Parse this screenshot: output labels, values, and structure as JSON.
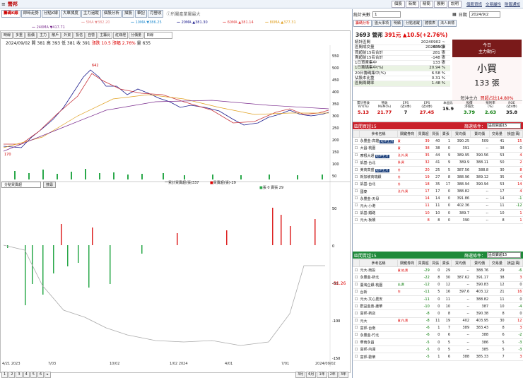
{
  "app": {
    "title": "營邦",
    "window_controls": [
      "個股",
      "新聞",
      "精簡",
      "展開",
      "說明"
    ],
    "links": [
      "個股資訊",
      "交易屬性",
      "財報通知"
    ]
  },
  "chart_tabs": [
    "籌碼K線",
    "即時走勢",
    "分點K線",
    "大單揉度",
    "主力追蹤",
    "個股分析",
    "描股",
    "筆記",
    "月營收"
  ],
  "chart_tabs_note": "ⓘ所屬產業屬最大",
  "ma": [
    {
      "label": "5MA ▼382.20",
      "color": "#e58a8a"
    },
    {
      "label": "10MA ▼386.25",
      "color": "#2a8fd0"
    },
    {
      "label": "20MA ▲381.30",
      "color": "#1a1a8c"
    },
    {
      "label": "60MA ▲381.14",
      "color": "#e23f3f"
    },
    {
      "label": "80MA ▲377.31",
      "color": "#e0a020"
    },
    {
      "label": "240MA ▼417.71",
      "color": "#7b2d8e"
    }
  ],
  "toolbar": [
    "時線",
    "多重",
    "股價",
    "主力",
    "散戶",
    "外資",
    "投信",
    "自營",
    "主籌比",
    "紅綠燈",
    "分價量"
  ],
  "period": "日線",
  "ohlc": {
    "text": "2024/09/02 開 381 高 393 低 381 收 391",
    "chg": "漲跌 10.5",
    "pct": "漲幅 2.76%",
    "vol": "量 635"
  },
  "peak_label": "642",
  "low_label": "170",
  "y_price": [
    "600",
    "550",
    "500",
    "450",
    "400",
    "350",
    "300",
    "250",
    "200",
    "150",
    "100",
    "50"
  ],
  "mid_select": "分點買賣超",
  "mid_button": "搜尋",
  "legend": {
    "line": "一累計買賣超(張)337",
    "buy": "買賣超(張)-29",
    "sell": "張 0 賣張 29"
  },
  "y_lower": [
    "50",
    "0",
    "-50",
    "-100",
    "-150"
  ],
  "last_val": "-31.26",
  "x_labels": [
    "4/21\n2023",
    "7/03",
    "10/02",
    "1/02\n2024",
    "4/01",
    "7/01",
    "2024/09/02"
  ],
  "bottom": {
    "pages": [
      "1",
      "2",
      "3",
      "4",
      "5",
      "6",
      "▸"
    ],
    "ranges": [
      "3月",
      "6月",
      "1年",
      "2年",
      "3年"
    ]
  },
  "controls": {
    "days_label": "統計天數",
    "days": "1",
    "date_label": "日期",
    "date": "2024/9/2"
  },
  "right_tabs": [
    "籌碼分析",
    "盤大事項",
    "明顯",
    "分點追蹤",
    "體檢表",
    "法人目標"
  ],
  "stock": {
    "code_name": "3693 營邦",
    "price": "391元",
    "chg": "▲10.5(+2.76%)"
  },
  "stats": [
    {
      "k": "統計區間",
      "v": "20240902 ~ 20240902",
      "alt": false
    },
    {
      "k": "區間成交量",
      "v": "635 張",
      "alt": false
    },
    {
      "k": "買超前15名合計",
      "v": "281 張",
      "alt": false
    },
    {
      "k": "賣超前15名合計",
      "v": "-148 張",
      "alt": false
    },
    {
      "k": "1日買賣集中",
      "v": "133 張",
      "alt": false
    },
    {
      "k": "1日籌碼集中(%)",
      "v": "20.94 %",
      "alt": true
    },
    {
      "k": "20日籌碼集中(%)",
      "v": "6.58 %",
      "alt": false
    },
    {
      "k": "佔股本比重",
      "v": "0.31 %",
      "alt": false
    },
    {
      "k": "區間周轉率",
      "v": "1.48 %",
      "alt": true
    }
  ],
  "today": {
    "a": "今日",
    "b": "主力動向",
    "action": "小買",
    "qty": "133 張",
    "who": "短沖主力",
    "pct": "買超占比14.80%"
  },
  "fin": [
    {
      "h": "累計營收\nYoY(%)",
      "v": "5.13",
      "c": "red"
    },
    {
      "h": "營收\nMoM(%)",
      "v": "21.77",
      "c": "red"
    },
    {
      "h": "EPS\n(近4季)",
      "v": "7",
      "c": "k"
    },
    {
      "h": "EPS\n(近4季)",
      "v": "27.45",
      "c": "red"
    },
    {
      "h": "本益比",
      "v": "15.9",
      "c": "k"
    },
    {
      "h": "股價\n淨值比",
      "v": "3.79",
      "c": "g"
    },
    {
      "h": "殖利率\n(%)",
      "v": "2.63",
      "c": "g"
    },
    {
      "h": "ROE\n(近4季)",
      "v": "35.8",
      "c": "k"
    }
  ],
  "buy_section": {
    "title": "區間買超15",
    "filter_label": "篩選條件：",
    "filter": "區間買超15"
  },
  "sell_section": {
    "title": "區間賣超15",
    "filter_label": "篩選條件：",
    "filter": "區間賣超15"
  },
  "cols": [
    "參考名稱",
    "關鍵券商",
    "買賣超",
    "買張",
    "賣張",
    "買均價",
    "賣均價",
    "交易量",
    "損益(萬)"
  ],
  "buy_rows": [
    {
      "name": "永豐金-高雄",
      "tag": "短沖主力",
      "k": "買",
      "kc": "red",
      "n": [
        "39",
        "40",
        "1",
        "390.25",
        "509",
        "41",
        "15"
      ]
    },
    {
      "name": "大昌-桃園",
      "tag": "",
      "k": "買",
      "kc": "red",
      "n": [
        "38",
        "38",
        "0",
        "391",
        "--",
        "38",
        "0"
      ]
    },
    {
      "name": "摩根大通",
      "tag": "短沖主力",
      "k": "法,外,買",
      "kc": "red",
      "n": [
        "35",
        "44",
        "9",
        "389.95",
        "390.56",
        "53",
        "4"
      ]
    },
    {
      "name": "凱基-台北",
      "tag": "",
      "k": "券,買",
      "kc": "red",
      "n": [
        "32",
        "41",
        "9",
        "389.9",
        "388.11",
        "50",
        "2"
      ]
    },
    {
      "name": "美商高盛",
      "tag": "短沖主力",
      "k": "外",
      "kc": "red",
      "n": [
        "20",
        "25",
        "5",
        "387.56",
        "388.8",
        "30",
        "8"
      ]
    },
    {
      "name": "新加坡商瑞銀",
      "tag": "",
      "k": "外",
      "kc": "red",
      "n": [
        "19",
        "27",
        "8",
        "388.96",
        "389.12",
        "35",
        "4"
      ]
    },
    {
      "name": "凱基-台北",
      "tag": "",
      "k": "外",
      "kc": "red",
      "n": [
        "18",
        "35",
        "17",
        "388.94",
        "390.94",
        "53",
        "14"
      ]
    },
    {
      "name": "國泰",
      "tag": "",
      "k": "法,作,買",
      "kc": "red",
      "n": [
        "17",
        "17",
        "0",
        "388.82",
        "--",
        "17",
        "4"
      ]
    },
    {
      "name": "永豐金-天母",
      "tag": "",
      "k": "",
      "kc": "red",
      "n": [
        "14",
        "14",
        "0",
        "391.86",
        "--",
        "14",
        "-1"
      ]
    },
    {
      "name": "元大-小港",
      "tag": "",
      "k": "",
      "kc": "red",
      "n": [
        "11",
        "11",
        "0",
        "402.36",
        "--",
        "11",
        "-12"
      ]
    },
    {
      "name": "凱基-鐵路",
      "tag": "",
      "k": "",
      "kc": "red",
      "n": [
        "10",
        "10",
        "0",
        "389.7",
        "--",
        "10",
        "1"
      ]
    },
    {
      "name": "元大-板橋",
      "tag": "",
      "k": "",
      "kc": "red",
      "n": [
        "8",
        "8",
        "0",
        "390",
        "--",
        "8",
        "1"
      ]
    }
  ],
  "sell_rows": [
    {
      "name": "元大-南投",
      "tag": "",
      "k": "買,地,賣",
      "kc": "red",
      "n": [
        "-29",
        "0",
        "29",
        "--",
        "388.76",
        "29",
        "-6"
      ]
    },
    {
      "name": "永豐金-新北",
      "tag": "",
      "k": "",
      "kc": "red",
      "n": [
        "-22",
        "8",
        "30",
        "387.62",
        "391.17",
        "38",
        "3"
      ]
    },
    {
      "name": "臺灣企銀-桃園",
      "tag": "",
      "k": "出,賣",
      "kc": "grn",
      "n": [
        "-12",
        "0",
        "12",
        "--",
        "390.83",
        "12",
        "0"
      ]
    },
    {
      "name": "台新",
      "tag": "",
      "k": "作",
      "kc": "red",
      "n": [
        "-11",
        "5",
        "16",
        "397.6",
        "403.12",
        "21",
        "16"
      ]
    },
    {
      "name": "元大-文心農安",
      "tag": "",
      "k": "",
      "kc": "red",
      "n": [
        "-11",
        "0",
        "11",
        "--",
        "388.82",
        "11",
        "0"
      ]
    },
    {
      "name": "群益金鼎-蘆華",
      "tag": "",
      "k": "",
      "kc": "red",
      "n": [
        "-10",
        "0",
        "10",
        "--",
        "387",
        "10",
        "-4"
      ]
    },
    {
      "name": "富邦-新店",
      "tag": "",
      "k": "",
      "kc": "red",
      "n": [
        "-8",
        "0",
        "8",
        "--",
        "390.38",
        "8",
        "0"
      ]
    },
    {
      "name": "元大",
      "tag": "",
      "k": "買,作,賣",
      "kc": "red",
      "n": [
        "-8",
        "11",
        "19",
        "402",
        "403.95",
        "30",
        "12"
      ]
    },
    {
      "name": "富邦-台南",
      "tag": "",
      "k": "",
      "kc": "red",
      "n": [
        "-6",
        "1",
        "7",
        "389",
        "383.43",
        "8",
        "3"
      ]
    },
    {
      "name": "永豐金-竹北",
      "tag": "",
      "k": "",
      "kc": "red",
      "n": [
        "-6",
        "0",
        "6",
        "--",
        "388",
        "6",
        "-2"
      ]
    },
    {
      "name": "華南永昌",
      "tag": "",
      "k": "",
      "kc": "red",
      "n": [
        "-5",
        "0",
        "5",
        "--",
        "386",
        "5",
        "-3"
      ]
    },
    {
      "name": "富邦-內湖",
      "tag": "",
      "k": "",
      "kc": "red",
      "n": [
        "-5",
        "0",
        "5",
        "--",
        "385",
        "5",
        "-3"
      ]
    },
    {
      "name": "富邦-歡樂",
      "tag": "",
      "k": "",
      "kc": "red",
      "n": [
        "-5",
        "1",
        "6",
        "388",
        "385.33",
        "7",
        "3"
      ]
    }
  ]
}
